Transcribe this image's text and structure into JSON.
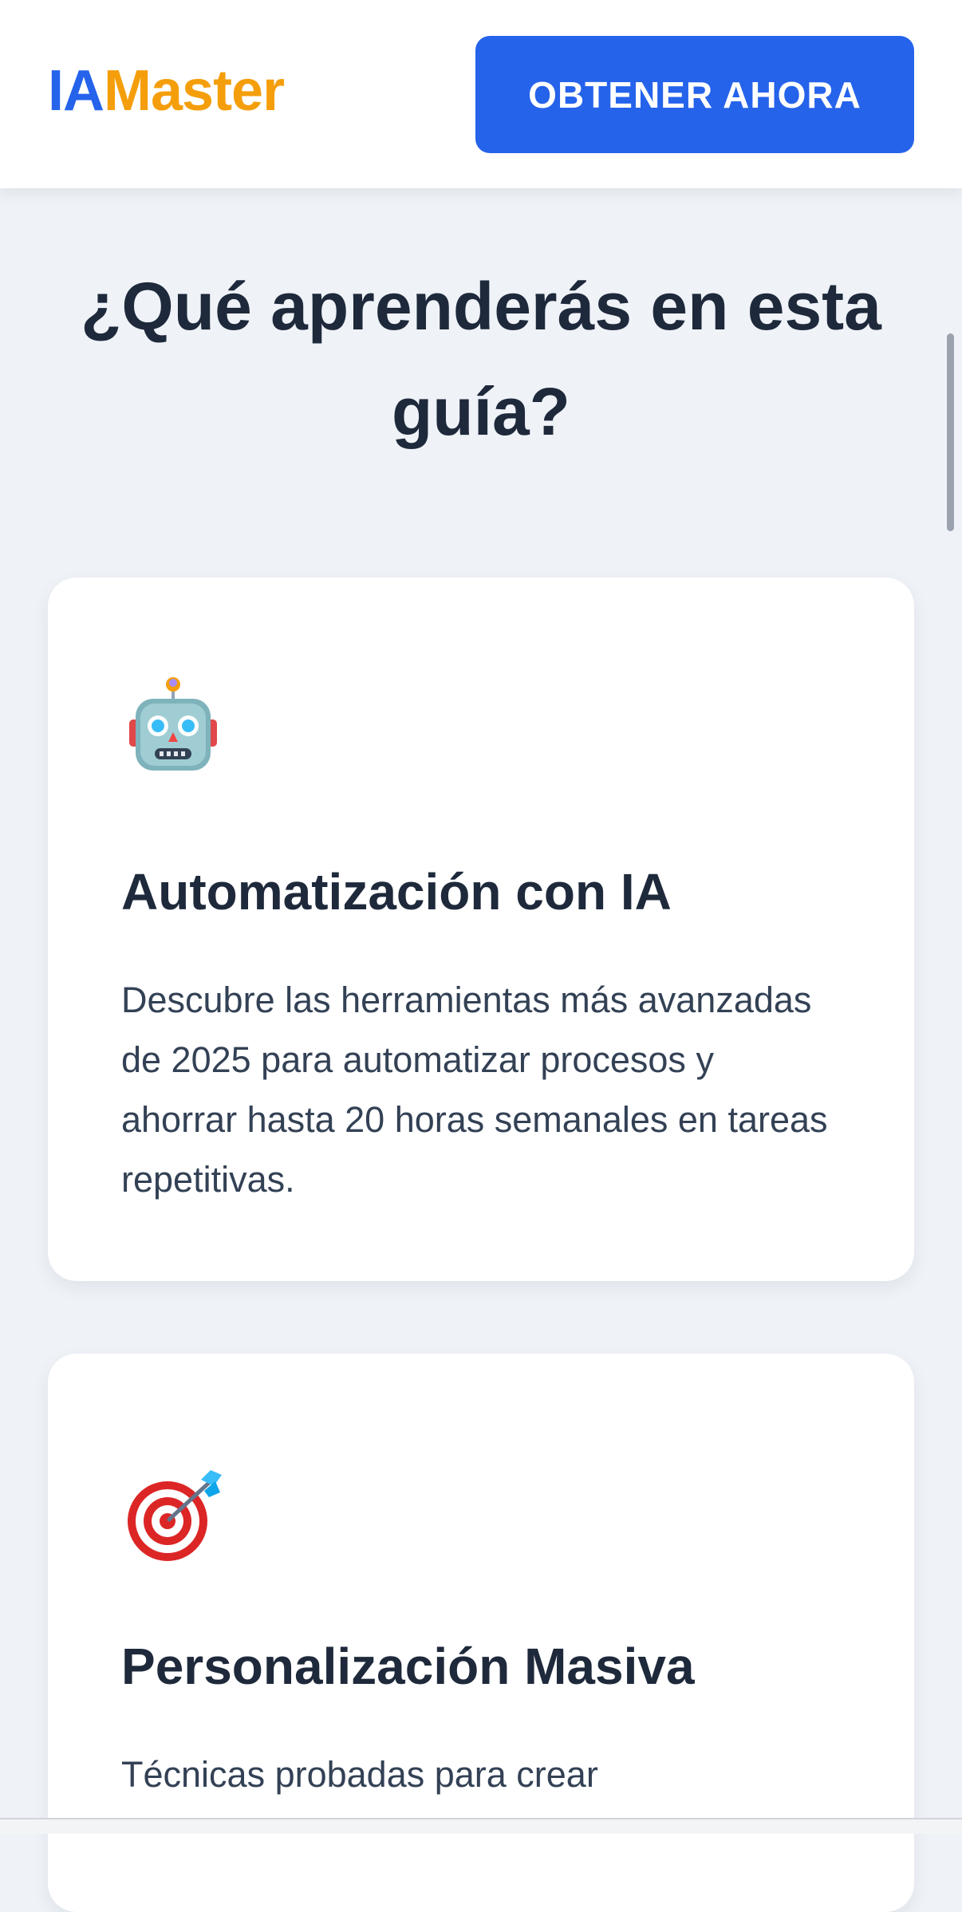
{
  "header": {
    "logo_part1": "IA",
    "logo_part2": "Master",
    "cta_label": "OBTENER AHORA"
  },
  "section": {
    "title": "¿Qué aprenderás en esta guía?"
  },
  "cards": [
    {
      "icon": "robot-icon",
      "title": "Automatización con IA",
      "description": "Descubre las herramientas más avanzadas de 2025 para automatizar procesos y ahorrar hasta 20 horas semanales en tareas repetitivas."
    },
    {
      "icon": "bullseye-dart-icon",
      "title": "Personalización Masiva",
      "description": "Técnicas probadas para crear"
    }
  ],
  "colors": {
    "brand_blue": "#2563eb",
    "brand_orange": "#f59e0b",
    "text_dark": "#1e293b",
    "page_bg": "#eff3f8"
  }
}
